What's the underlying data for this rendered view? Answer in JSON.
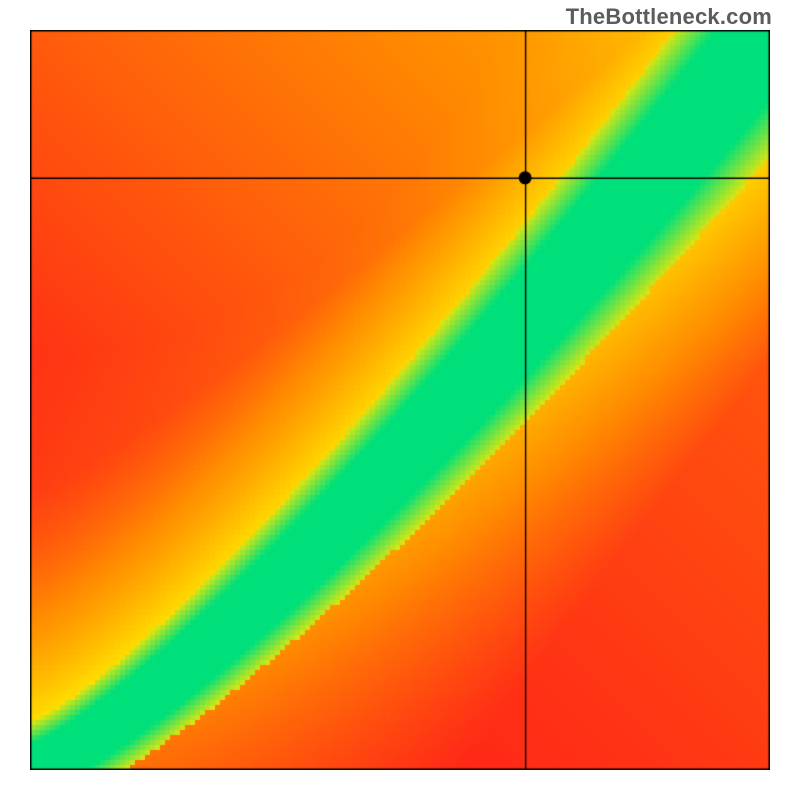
{
  "watermark": "TheBottleneck.com",
  "chart_data": {
    "type": "heatmap",
    "title": "",
    "xlabel": "",
    "ylabel": "",
    "xlim": [
      0,
      1
    ],
    "ylim": [
      0,
      1
    ],
    "crosshair": {
      "x": 0.67,
      "y": 0.8
    },
    "dot": {
      "x": 0.67,
      "y": 0.8
    },
    "color_scale": [
      "#ff1a1a",
      "#ff8c00",
      "#ffe600",
      "#00e07a"
    ],
    "optimum_band": {
      "description": "Diagonal green band y ≈ x^1.25, band half-width ≈ 0.05 widening toward top-right",
      "exponent": 1.25,
      "band_half_width_base": 0.035,
      "band_half_width_growth": 0.06
    },
    "notes": "Red = strong bottleneck, yellow/orange = moderate, green = balanced. Crosshair point at (0.67, 0.80) falls in orange/yellow region (CPU-limited)."
  }
}
